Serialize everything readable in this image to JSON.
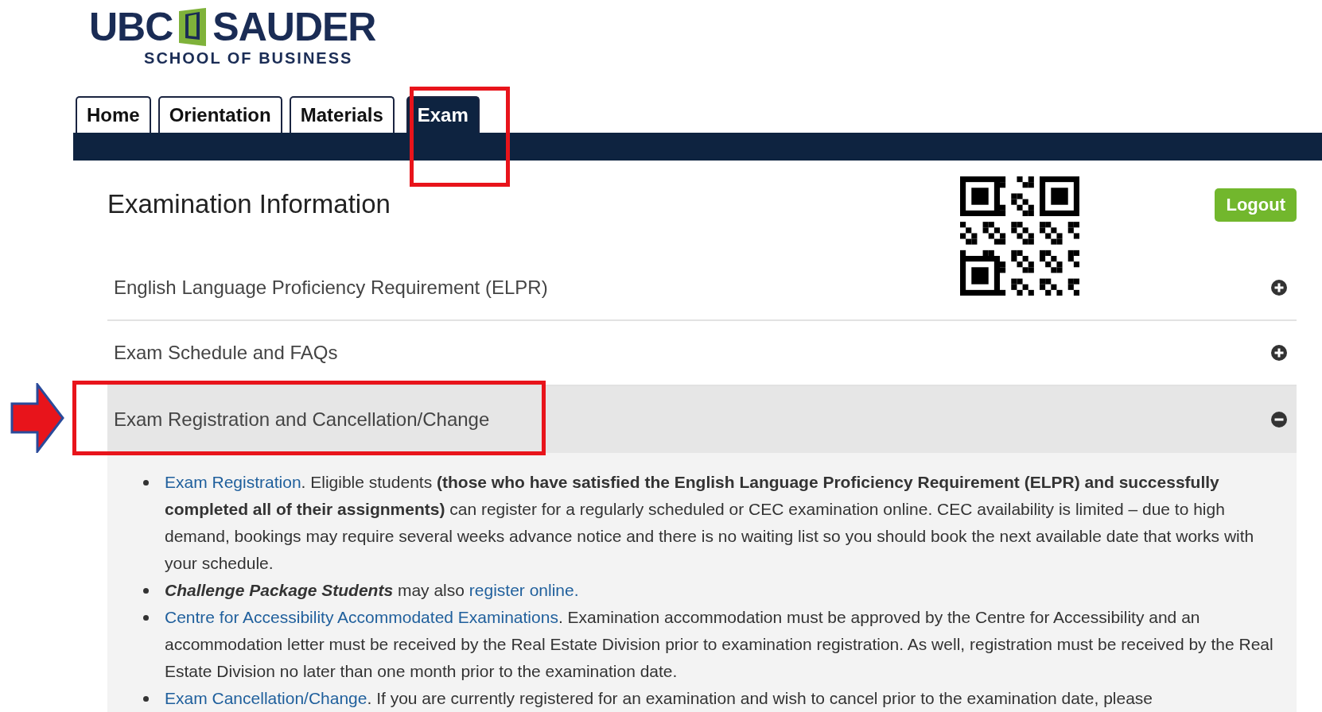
{
  "logo": {
    "primary": "UBC",
    "secondary": "SAUDER",
    "tagline": "SCHOOL OF BUSINESS"
  },
  "tabs": [
    {
      "label": "Home",
      "selected": false
    },
    {
      "label": "Orientation",
      "selected": false
    },
    {
      "label": "Materials",
      "selected": false
    },
    {
      "label": "Exam",
      "selected": true
    }
  ],
  "heading": "Examination Information",
  "logout_button": "Logout",
  "sections": [
    {
      "title": "English Language Proficiency Requirement (ELPR)",
      "expanded": false
    },
    {
      "title": "Exam Schedule and FAQs",
      "expanded": false
    },
    {
      "title": "Exam Registration and Cancellation/Change",
      "expanded": true,
      "items": [
        {
          "parts": [
            {
              "kind": "link",
              "text": "Exam Registration"
            },
            {
              "kind": "text",
              "text": ". Eligible students **(those who have satisfied the English Language Proficiency Requirement (ELPR) and successfully completed all of their assignments)** can register for a regularly scheduled or CEC examination online. CEC availability is limited – due to high demand, bookings may require several weeks advance notice and there is no waiting list so you should book the next available date that works with your schedule."
            }
          ]
        },
        {
          "parts": [
            {
              "kind": "emphasis",
              "text": "Challenge Package Students"
            },
            {
              "kind": "text",
              "text": " may also "
            },
            {
              "kind": "link",
              "text": "register online."
            }
          ]
        },
        {
          "parts": [
            {
              "kind": "link",
              "text": "Centre for Accessibility Accommodated Examinations"
            },
            {
              "kind": "text",
              "text": ". Examination accommodation must be approved by the Centre for Accessibility and an accommodation letter must be received by the Real Estate Division prior to examination registration. As well, registration must be received by the Real Estate Division no later than one month prior to the examination date."
            }
          ]
        },
        {
          "parts": [
            {
              "kind": "link",
              "text": "Exam Cancellation/Change"
            },
            {
              "kind": "text",
              "text": ". If you are currently registered for an examination and wish to cancel prior to the examination date, please"
            }
          ]
        }
      ]
    }
  ]
}
